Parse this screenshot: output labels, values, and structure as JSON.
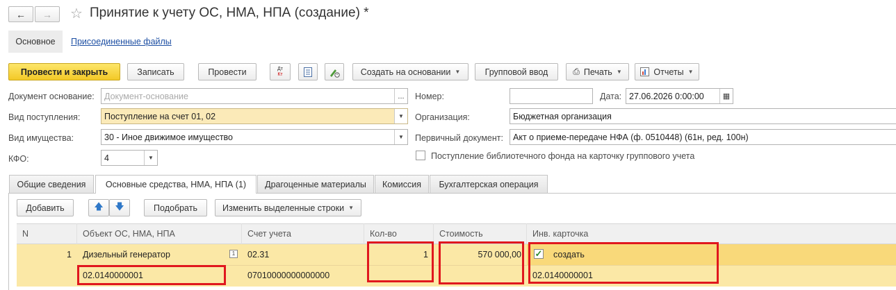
{
  "window": {
    "title": "Принятие к учету ОС, НМА, НПА (создание) *",
    "star_icon": "star-icon"
  },
  "subnav": {
    "main_label": "Основное",
    "files_link": "Присоединенные файлы"
  },
  "toolbar": {
    "post_close": "Провести и закрыть",
    "save": "Записать",
    "post": "Провести",
    "dt_kt": "Дт Кт",
    "create_based": "Создать на основании",
    "group_input": "Групповой ввод",
    "print": "Печать",
    "reports": "Отчеты"
  },
  "form": {
    "doc_basis_label": "Документ основание:",
    "doc_basis_placeholder": "Документ-основание",
    "receipt_type_label": "Вид поступления:",
    "receipt_type_value": "Поступление на счет 01, 02",
    "property_type_label": "Вид имущества:",
    "property_type_value": "30 - Иное движимое имущество",
    "kfo_label": "КФО:",
    "kfo_value": "4",
    "number_label": "Номер:",
    "number_value": "",
    "date_label": "Дата:",
    "date_value": "27.06.2026  0:00:00",
    "org_label": "Организация:",
    "org_value": "Бюджетная организация",
    "primary_doc_label": "Первичный документ:",
    "primary_doc_value": "Акт о приеме-передаче НФА (ф. 0510448) (61н, ред. 100н)",
    "library_checkbox_label": "Поступление библиотечного фонда на карточку группового учета",
    "library_checked": false
  },
  "tabs": [
    {
      "label": "Общие сведения",
      "active": false
    },
    {
      "label": "Основные средства, НМА, НПА (1)",
      "active": true
    },
    {
      "label": "Драгоценные материалы",
      "active": false
    },
    {
      "label": "Комиссия",
      "active": false
    },
    {
      "label": "Бухгалтерская операция",
      "active": false
    }
  ],
  "table_toolbar": {
    "add": "Добавить",
    "pick": "Подобрать",
    "change_rows": "Изменить выделенные строки"
  },
  "table": {
    "columns": [
      "N",
      "Объект ОС, НМА, НПА",
      "Счет учета",
      "Кол-во",
      "Стоимость",
      "Инв. карточка"
    ],
    "rows": [
      {
        "n": "1",
        "object": "Дизельный генератор",
        "object_code": "02.0140000001",
        "account": "02.31",
        "account_code": "07010000000000000",
        "qty": "1",
        "cost": "570 000,00",
        "card_checked": true,
        "card_action": "создать",
        "card_code": "02.0140000001"
      }
    ]
  },
  "colors": {
    "accent_yellow": "#f3c927",
    "field_yellow": "#fbeab8",
    "row_yellow": "#fbe8a6",
    "highlight_red": "#e0171e"
  }
}
